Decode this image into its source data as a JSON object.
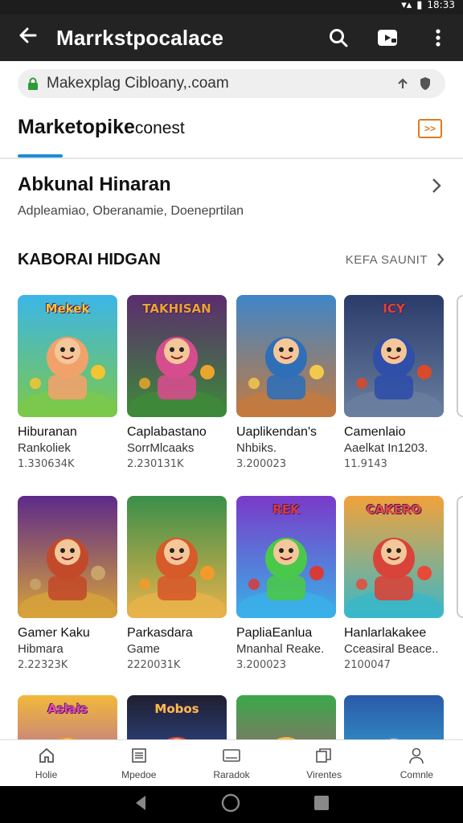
{
  "status_bar": {
    "time": "18:33"
  },
  "app_bar": {
    "title": "Marrkstpocalace",
    "icons": [
      "back-arrow-icon",
      "search-icon",
      "video-icon",
      "more-vert-icon"
    ]
  },
  "url_bar": {
    "url": "Makexplag Cibloany,.coam"
  },
  "tab": {
    "title": "Marketopike",
    "subtitle": "conest",
    "badge": ">>"
  },
  "section_a": {
    "title": "Abkunal Hinaran",
    "subtitle": "Adpleamiao,  Oberanamie,  Doeneprtilan"
  },
  "section_b": {
    "title": "KABORAI HIDGAN",
    "more": "KEFA SAUNIT"
  },
  "cards": [
    {
      "title": "Hiburanan",
      "sub": "Rankoliek",
      "count": "1.330634K",
      "theme": {
        "bg1": "#3bb6e8",
        "bg2": "#7cc84a",
        "accent": "#f4c431",
        "char": "#f1a26b"
      },
      "sign": "Mekek"
    },
    {
      "title": "Caplabastano",
      "sub": "SorrMlcaaks",
      "count": "2.230131K",
      "theme": {
        "bg1": "#5b2d6e",
        "bg2": "#3e8a3a",
        "accent": "#e9a62b",
        "char": "#d64d8d"
      },
      "sign": "TAKHISAN"
    },
    {
      "title": "Uaplikendan's",
      "sub": "Nhbiks.",
      "count": "3.200023",
      "theme": {
        "bg1": "#3f86c8",
        "bg2": "#c47a3f",
        "accent": "#f2c94c",
        "char": "#2f6fb8"
      },
      "sign": ""
    },
    {
      "title": "Camenlaio",
      "sub": "Aaelkat In1203.",
      "count": "11.9143",
      "theme": {
        "bg1": "#2a3b6a",
        "bg2": "#6a7fa0",
        "accent": "#d94a2a",
        "char": "#2f4fa8"
      },
      "sign": "ICY"
    },
    {
      "title": "Gamer Kaku",
      "sub": "Hibmara",
      "count": "2.22323K",
      "theme": {
        "bg1": "#5d2a8a",
        "bg2": "#d7a23a",
        "accent": "#c8a46a",
        "char": "#c24a2a"
      },
      "sign": ""
    },
    {
      "title": "Parkasdara",
      "sub": "Game",
      "count": "2220031K",
      "theme": {
        "bg1": "#3a8f4a",
        "bg2": "#e8b34a",
        "accent": "#f29a2a",
        "char": "#d65a2a"
      },
      "sign": ""
    },
    {
      "title": "PapliaEanlua",
      "sub": "Mnanhal Reake.",
      "count": "3.200023",
      "theme": {
        "bg1": "#7a3ac8",
        "bg2": "#3ab0e8",
        "accent": "#d83a3a",
        "char": "#4ac84a"
      },
      "sign": "REK"
    },
    {
      "title": "Hanlarlakakee",
      "sub": "Cceasiral Beace..",
      "count": "2100047",
      "theme": {
        "bg1": "#f2a23a",
        "bg2": "#3ab8c8",
        "accent": "#e84a3a",
        "char": "#d8443a"
      },
      "sign": "CAKERO"
    },
    {
      "title": "",
      "sub": "",
      "count": "",
      "theme": {
        "bg1": "#f2b93a",
        "bg2": "#8a3ad8",
        "accent": "#e84aa8",
        "char": "#f29a2a"
      },
      "sign": "Aslais"
    },
    {
      "title": "",
      "sub": "",
      "count": "",
      "theme": {
        "bg1": "#1f1f2f",
        "bg2": "#3a6ad8",
        "accent": "#f2c43a",
        "char": "#e84a3a"
      },
      "sign": "Mobos"
    },
    {
      "title": "",
      "sub": "",
      "count": "",
      "theme": {
        "bg1": "#3aa84a",
        "bg2": "#d83a8a",
        "accent": "#f2c43a",
        "char": "#f2b83a"
      },
      "sign": ""
    },
    {
      "title": "",
      "sub": "",
      "count": "",
      "theme": {
        "bg1": "#2a5aa8",
        "bg2": "#3ac8e8",
        "accent": "#f2c43a",
        "char": "#2a8ad8"
      },
      "sign": ""
    }
  ],
  "bottom_nav": [
    {
      "label": "Holie",
      "icon": "home-icon"
    },
    {
      "label": "Mpedoe",
      "icon": "list-icon"
    },
    {
      "label": "Raradok",
      "icon": "tablet-icon"
    },
    {
      "label": "Virentes",
      "icon": "library-icon"
    },
    {
      "label": "Comnle",
      "icon": "person-icon"
    }
  ]
}
